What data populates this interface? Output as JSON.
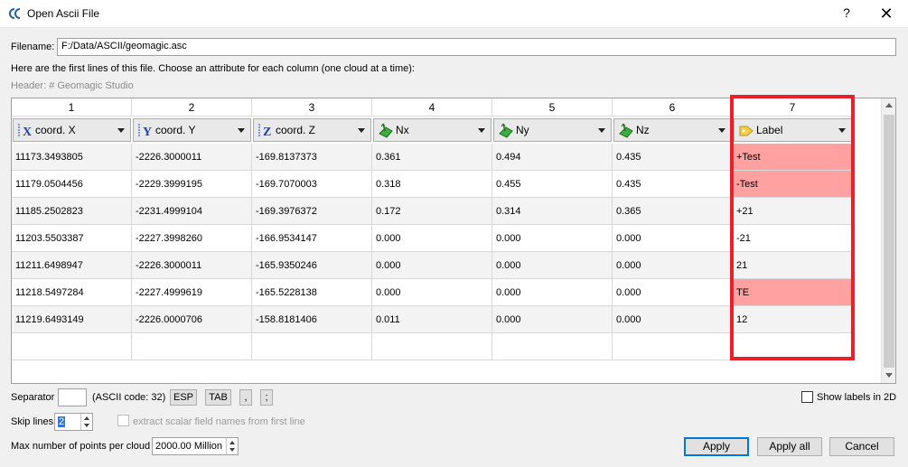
{
  "window": {
    "title": "Open Ascii File",
    "help": "?",
    "close": "✕"
  },
  "filename": {
    "label": "Filename:",
    "value": "F:/Data/ASCII/geomagic.asc"
  },
  "instructions": "Here are the first lines of this file. Choose an attribute for each column (one cloud at a time):",
  "header_line": "Header: # Geomagic Studio",
  "columns": [
    {
      "number": "1",
      "attribute": "coord. X",
      "icon": "x-axis-icon"
    },
    {
      "number": "2",
      "attribute": "coord. Y",
      "icon": "y-axis-icon"
    },
    {
      "number": "3",
      "attribute": "coord. Z",
      "icon": "z-axis-icon"
    },
    {
      "number": "4",
      "attribute": "Nx",
      "icon": "normal-icon"
    },
    {
      "number": "5",
      "attribute": "Ny",
      "icon": "normal-icon"
    },
    {
      "number": "6",
      "attribute": "Nz",
      "icon": "normal-icon"
    },
    {
      "number": "7",
      "attribute": "Label",
      "icon": "label-icon"
    }
  ],
  "rows": [
    [
      "11173.3493805",
      "-2226.3000011",
      "-169.8137373",
      "0.361",
      "0.494",
      "0.435",
      "+Test"
    ],
    [
      "11179.0504456",
      "-2229.3999195",
      "-169.7070003",
      "0.318",
      "0.455",
      "0.435",
      "-Test"
    ],
    [
      "11185.2502823",
      "-2231.4999104",
      "-169.3976372",
      "0.172",
      "0.314",
      "0.365",
      "+21"
    ],
    [
      "11203.5503387",
      "-2227.3998260",
      "-166.9534147",
      "0.000",
      "0.000",
      "0.000",
      "-21"
    ],
    [
      "11211.6498947",
      "-2226.3000011",
      "-165.9350246",
      "0.000",
      "0.000",
      "0.000",
      "21"
    ],
    [
      "11218.5497284",
      "-2227.4999619",
      "-165.5228138",
      "0.000",
      "0.000",
      "0.000",
      "TE"
    ],
    [
      "11219.6493149",
      "-2226.0000706",
      "-158.8181406",
      "0.011",
      "0.000",
      "0.000",
      "12"
    ]
  ],
  "highlighted_label_rows": [
    0,
    1,
    5
  ],
  "colors": {
    "highlight": "#ffa1a1",
    "annotation_box": "#e8202a",
    "accent": "#0078d7"
  },
  "separator": {
    "label": "Separator",
    "value": "",
    "ascii_code": "(ASCII code: 32)",
    "buttons": [
      "ESP",
      "TAB",
      ",",
      ";"
    ]
  },
  "show_labels_2d": {
    "label": "Show labels in 2D",
    "checked": false
  },
  "skip_lines": {
    "label": "Skip lines",
    "value": "2"
  },
  "extract_names": {
    "label": "extract scalar field names from first line",
    "checked": false,
    "enabled": false
  },
  "max_points": {
    "label": "Max number of points per cloud",
    "value": "2000.00 Million"
  },
  "buttons": {
    "apply": "Apply",
    "apply_all": "Apply all",
    "cancel": "Cancel"
  }
}
